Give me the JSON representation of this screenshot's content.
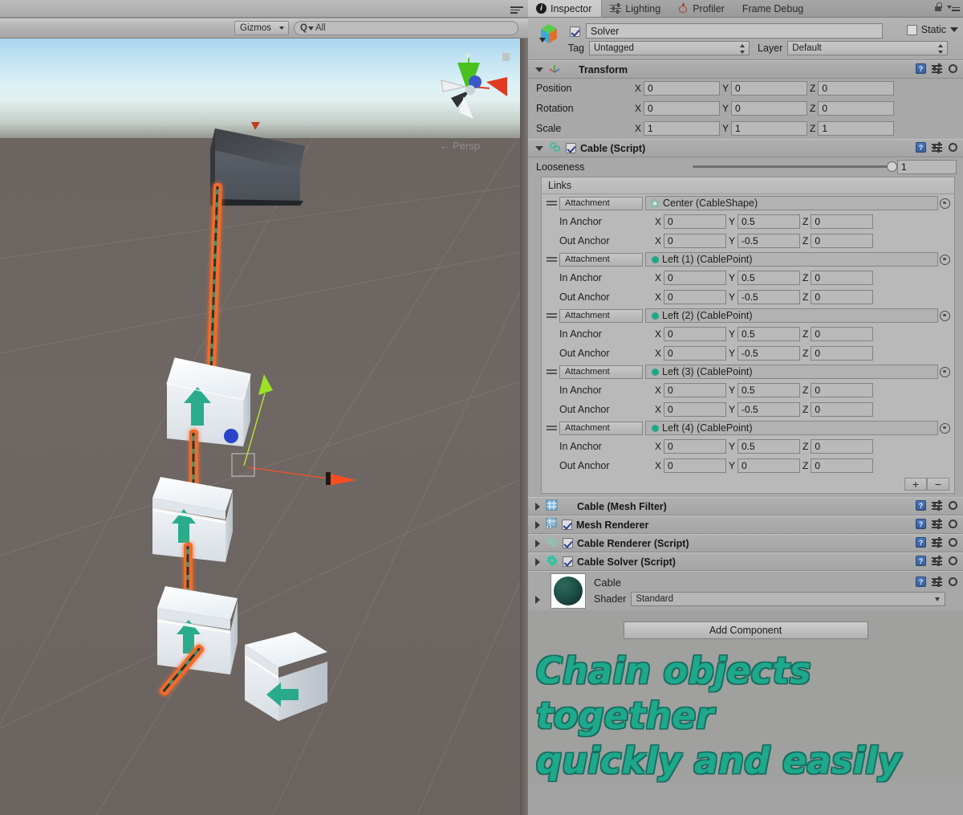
{
  "scene": {
    "toolbar": {
      "gizmos_label": "Gizmos",
      "search_value": "All",
      "search_prefix": "Q"
    },
    "view_gizmo": {
      "y_axis_label": "y",
      "projection_label": "Persp"
    }
  },
  "inspector": {
    "tabs": [
      {
        "label": "Inspector",
        "icon": "info-icon",
        "active": true
      },
      {
        "label": "Lighting",
        "icon": "lighting-icon",
        "active": false
      },
      {
        "label": "Profiler",
        "icon": "profiler-icon",
        "active": false
      },
      {
        "label": "Frame Debug",
        "icon": "",
        "active": false
      }
    ],
    "object_header": {
      "enabled": true,
      "name": "Solver",
      "static_label": "Static",
      "tag_label": "Tag",
      "tag_value": "Untagged",
      "layer_label": "Layer",
      "layer_value": "Default"
    },
    "transform": {
      "title": "Transform",
      "rows": [
        {
          "label": "Position",
          "x": "0",
          "y": "0",
          "z": "0"
        },
        {
          "label": "Rotation",
          "x": "0",
          "y": "0",
          "z": "0"
        },
        {
          "label": "Scale",
          "x": "1",
          "y": "1",
          "z": "1"
        }
      ]
    },
    "cable_script": {
      "title": "Cable (Script)",
      "enabled": true,
      "looseness_label": "Looseness",
      "looseness_value": "1",
      "links_header": "Links",
      "links": [
        {
          "type": "Attachment",
          "target": "Center (CableShape)",
          "target_icon": "star-icon",
          "in_label": "In Anchor",
          "in_x": "0",
          "in_y": "0.5",
          "in_z": "0",
          "out_label": "Out Anchor",
          "out_x": "0",
          "out_y": "-0.5",
          "out_z": "0"
        },
        {
          "type": "Attachment",
          "target": "Left (1) (CablePoint)",
          "target_icon": "dot-icon",
          "in_label": "In Anchor",
          "in_x": "0",
          "in_y": "0.5",
          "in_z": "0",
          "out_label": "Out Anchor",
          "out_x": "0",
          "out_y": "-0.5",
          "out_z": "0"
        },
        {
          "type": "Attachment",
          "target": "Left (2) (CablePoint)",
          "target_icon": "dot-icon",
          "in_label": "In Anchor",
          "in_x": "0",
          "in_y": "0.5",
          "in_z": "0",
          "out_label": "Out Anchor",
          "out_x": "0",
          "out_y": "-0.5",
          "out_z": "0"
        },
        {
          "type": "Attachment",
          "target": "Left (3) (CablePoint)",
          "target_icon": "dot-icon",
          "in_label": "In Anchor",
          "in_x": "0",
          "in_y": "0.5",
          "in_z": "0",
          "out_label": "Out Anchor",
          "out_x": "0",
          "out_y": "-0.5",
          "out_z": "0"
        },
        {
          "type": "Attachment",
          "target": "Left (4) (CablePoint)",
          "target_icon": "dot-icon",
          "in_label": "In Anchor",
          "in_x": "0",
          "in_y": "0.5",
          "in_z": "0",
          "out_label": "Out Anchor",
          "out_x": "0",
          "out_y": "0",
          "out_z": "0"
        }
      ],
      "add_link_label": "+",
      "remove_link_label": "−"
    },
    "components": [
      {
        "title": "Cable (Mesh Filter)",
        "has_checkbox": false,
        "enabled": false,
        "icon": "mesh-filter-icon"
      },
      {
        "title": "Mesh Renderer",
        "has_checkbox": true,
        "enabled": true,
        "icon": "mesh-renderer-icon"
      },
      {
        "title": "Cable Renderer (Script)",
        "has_checkbox": true,
        "enabled": true,
        "icon": "cable-renderer-icon"
      },
      {
        "title": "Cable Solver (Script)",
        "has_checkbox": true,
        "enabled": true,
        "icon": "cable-solver-icon"
      }
    ],
    "material": {
      "name": "Cable",
      "shader_label": "Shader",
      "shader_value": "Standard"
    },
    "add_component_label": "Add Component",
    "tagline_line1": "Chain objects together",
    "tagline_line2": "quickly and easily"
  },
  "colors": {
    "accent_teal": "#1ea88c",
    "accent_teal_outline": "#176b5d",
    "chain_orange": "#f4692a",
    "panel_bg": "#a8a8a8",
    "ground": "#6a635f",
    "gizmo_green": "#40c010",
    "gizmo_red": "#e03a20",
    "gizmo_blue": "#3a58c8"
  }
}
